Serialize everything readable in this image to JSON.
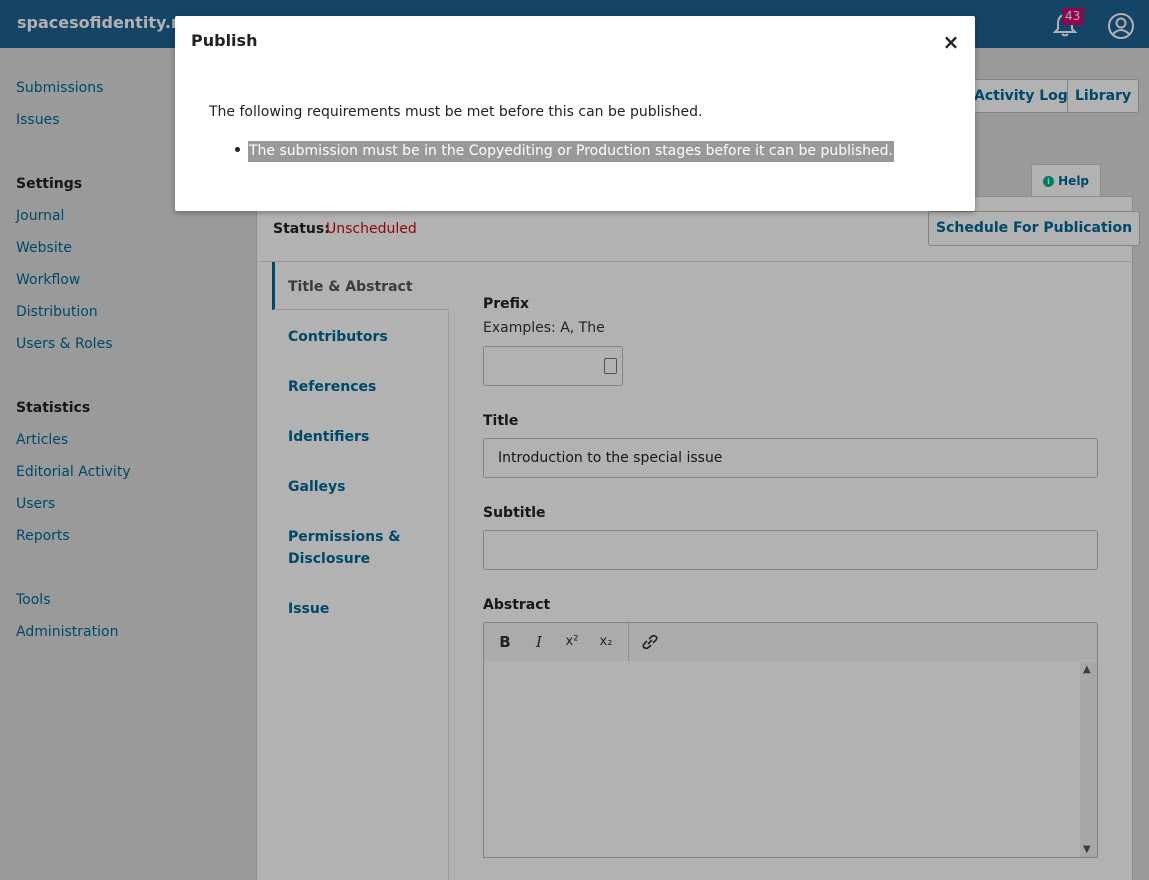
{
  "header": {
    "site_title": "spacesofidentity.net",
    "notification_count": "43"
  },
  "sidebar": {
    "links_top": [
      "Submissions",
      "Issues"
    ],
    "settings_heading": "Settings",
    "settings_links": [
      "Journal",
      "Website",
      "Workflow",
      "Distribution",
      "Users & Roles"
    ],
    "statistics_heading": "Statistics",
    "statistics_links": [
      "Articles",
      "Editorial Activity",
      "Users",
      "Reports"
    ],
    "other_links": [
      "Tools",
      "Administration"
    ]
  },
  "main": {
    "activity_log_label": "Activity Log",
    "library_label": "Library",
    "help_label": "Help",
    "status_label": "Status:",
    "status_value": "Unscheduled",
    "schedule_label": "Schedule For Publication",
    "tabs": [
      "Title & Abstract",
      "Contributors",
      "References",
      "Identifiers",
      "Galleys",
      "Permissions & Disclosure",
      "Issue"
    ],
    "fields": {
      "prefix_label": "Prefix",
      "prefix_desc": "Examples: A, The",
      "prefix_value": "",
      "title_label": "Title",
      "title_value": "Introduction to the special issue",
      "subtitle_label": "Subtitle",
      "subtitle_value": "",
      "abstract_label": "Abstract"
    },
    "editor_toolbar": [
      "bold-icon",
      "italic-icon",
      "superscript-icon",
      "subscript-icon",
      "link-icon"
    ]
  },
  "modal": {
    "title": "Publish",
    "close_glyph": "×",
    "message": "The following requirements must be met before this can be published.",
    "requirement": "The submission must be in the Copyediting or Production stages before it can be published."
  },
  "colors": {
    "topbar": "#1e6292",
    "link": "#006798",
    "status": "#d00a0a",
    "badge": "#d00a6c"
  }
}
